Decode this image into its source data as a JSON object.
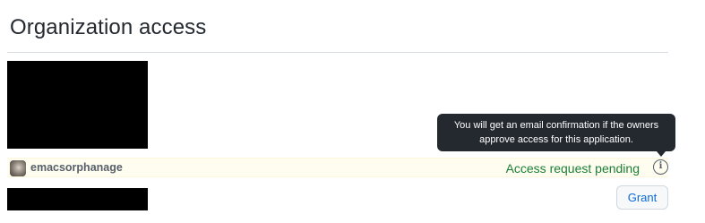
{
  "section": {
    "title": "Organization access"
  },
  "org_row": {
    "name": "emacsorphanage",
    "status": "Access request pending",
    "info_icon": "info-icon",
    "info_glyph": "i"
  },
  "tooltip": {
    "line1": "You will get an email confirmation if the owners",
    "line2": "approve access for this application."
  },
  "second_row": {
    "grant_label": "Grant"
  },
  "colors": {
    "pending": "#1a7f37",
    "row_highlight": "#fffdef",
    "tooltip_bg": "#24292f",
    "link_blue": "#0969da"
  }
}
